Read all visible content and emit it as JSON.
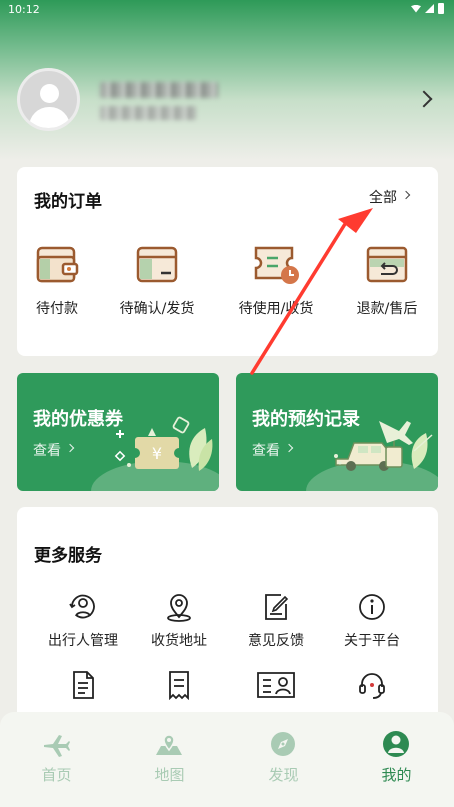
{
  "status_bar": {
    "time": "10:12"
  },
  "profile": {
    "arrow_icon": "chevron-right-icon"
  },
  "orders": {
    "title": "我的订单",
    "all_label": "全部",
    "items": [
      {
        "label": "待付款",
        "icon": "wallet-icon"
      },
      {
        "label": "待确认/发货",
        "icon": "box-icon"
      },
      {
        "label": "待使用/收货",
        "icon": "ticket-clock-icon"
      },
      {
        "label": "退款/售后",
        "icon": "return-box-icon"
      }
    ]
  },
  "promos": [
    {
      "title": "我的优惠券",
      "view_label": "查看",
      "icon": "coupon-icon"
    },
    {
      "title": "我的预约记录",
      "view_label": "查看",
      "icon": "travel-car-icon"
    }
  ],
  "services": {
    "title": "更多服务",
    "items": [
      {
        "label": "出行人管理",
        "icon": "person-refresh-icon"
      },
      {
        "label": "收货地址",
        "icon": "location-pin-icon"
      },
      {
        "label": "意见反馈",
        "icon": "edit-note-icon"
      },
      {
        "label": "关于平台",
        "icon": "info-icon"
      },
      {
        "label": "",
        "icon": "document-icon"
      },
      {
        "label": "",
        "icon": "receipt-icon"
      },
      {
        "label": "",
        "icon": "id-card-icon"
      },
      {
        "label": "",
        "icon": "headset-icon"
      }
    ]
  },
  "tabbar": {
    "items": [
      {
        "label": "首页",
        "icon": "plane-icon",
        "active": false
      },
      {
        "label": "地图",
        "icon": "map-icon",
        "active": false
      },
      {
        "label": "发现",
        "icon": "compass-icon",
        "active": false
      },
      {
        "label": "我的",
        "icon": "user-icon",
        "active": true
      }
    ]
  },
  "colors": {
    "brand": "#2f9a5b",
    "tab_active": "#2e8a52",
    "tab_inactive": "#a9cbb4",
    "annotation_arrow": "#ff3b30"
  }
}
